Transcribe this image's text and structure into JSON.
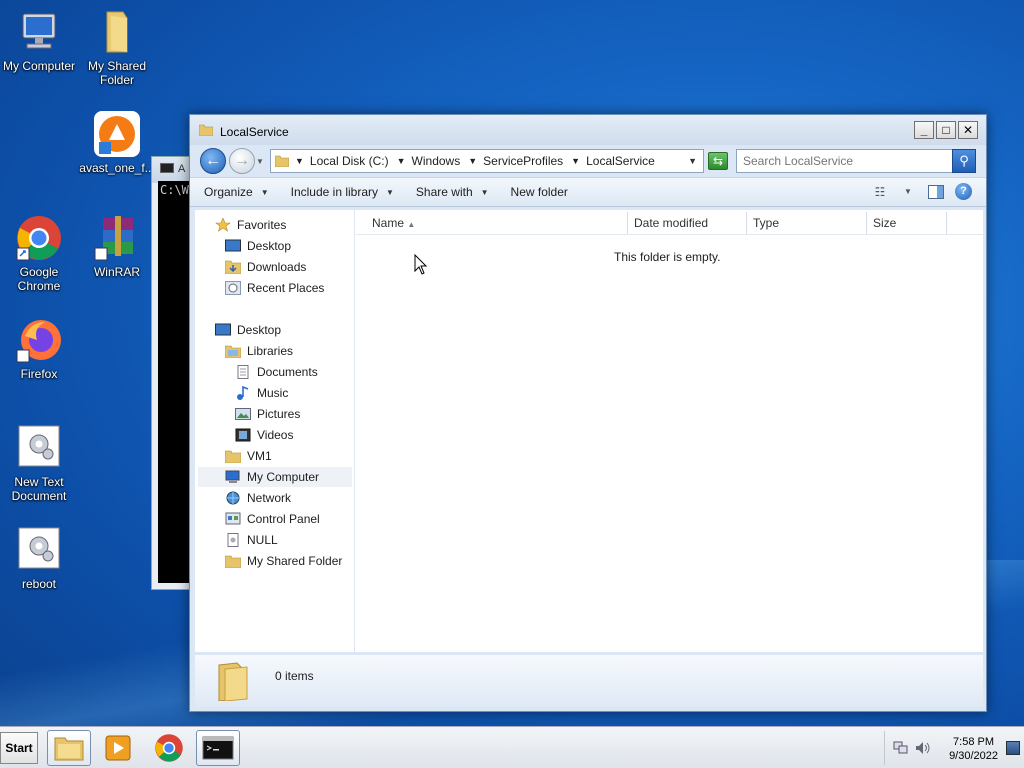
{
  "desktop": {
    "icons": [
      {
        "label": "My Computer"
      },
      {
        "label": "My Shared Folder"
      },
      {
        "label": "avast_one_f..."
      },
      {
        "label": "Google Chrome"
      },
      {
        "label": "WinRAR"
      },
      {
        "label": "Firefox"
      },
      {
        "label": "New Text Document"
      },
      {
        "label": "reboot"
      }
    ]
  },
  "console": {
    "title_fragment": "A",
    "prompt_fragment": "C:\\W"
  },
  "explorer": {
    "title": "LocalService",
    "window_buttons": {
      "minimize": "_",
      "maximize": "□",
      "close": "✕"
    },
    "address": {
      "crumbs": [
        "Local Disk (C:)",
        "Windows",
        "ServiceProfiles",
        "LocalService"
      ]
    },
    "search": {
      "placeholder": "Search LocalService"
    },
    "toolbar": {
      "organize": "Organize",
      "include_in_library": "Include in library",
      "share_with": "Share with",
      "new_folder": "New folder"
    },
    "nav": {
      "favorites": "Favorites",
      "desktop": "Desktop",
      "downloads": "Downloads",
      "recent_places": "Recent Places",
      "desktop_root": "Desktop",
      "libraries": "Libraries",
      "documents": "Documents",
      "music": "Music",
      "pictures": "Pictures",
      "videos": "Videos",
      "vm1": "VM1",
      "my_computer": "My Computer",
      "network": "Network",
      "control_panel": "Control Panel",
      "null": "NULL",
      "my_shared_folder": "My Shared Folder"
    },
    "columns": {
      "name": "Name",
      "date_modified": "Date modified",
      "type": "Type",
      "size": "Size"
    },
    "empty_message": "This folder is empty.",
    "details": {
      "count": "0 items"
    }
  },
  "taskbar": {
    "start": "Start",
    "clock_time": "7:58 PM",
    "clock_date": "9/30/2022"
  }
}
